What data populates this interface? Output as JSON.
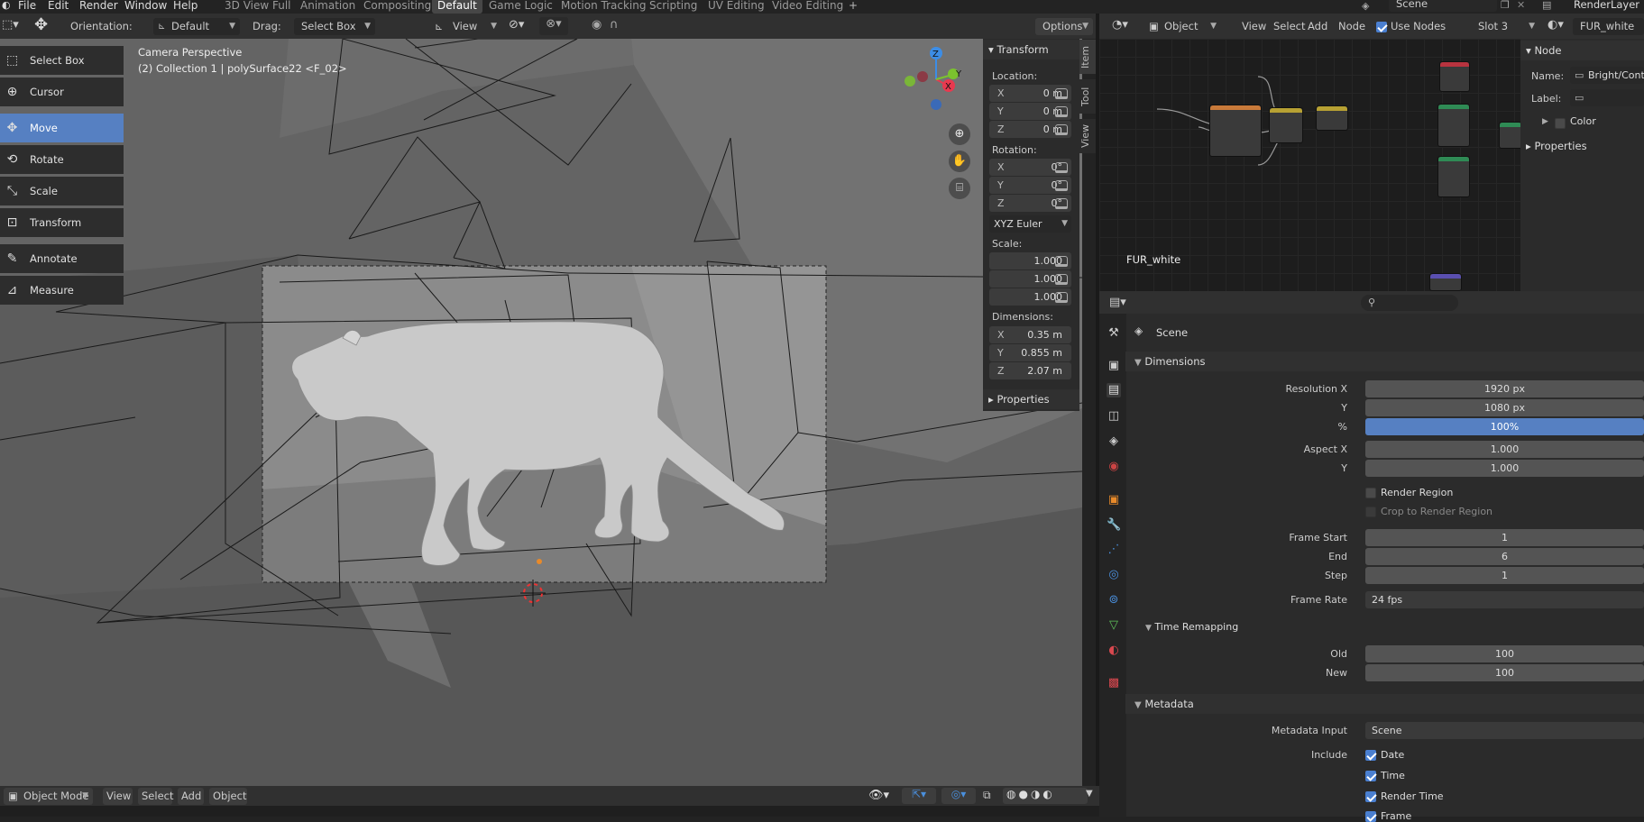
{
  "topbar": {
    "menus": [
      "File",
      "Edit",
      "Render",
      "Window",
      "Help"
    ],
    "workspaces": [
      "3D View Full",
      "Animation",
      "Compositing",
      "Default",
      "Game Logic",
      "Motion Tracking",
      "Scripting",
      "UV Editing",
      "Video Editing"
    ],
    "active_workspace": "Default",
    "add_tab": "+",
    "scene_name": "Scene",
    "view_layer": "RenderLayer"
  },
  "viewport_header": {
    "orientation_label": "Orientation:",
    "orientation_value": "Default",
    "drag_label": "Drag:",
    "drag_value": "Select Box",
    "view_menu": "View",
    "options_label": "Options"
  },
  "tools": [
    {
      "name": "Select Box",
      "icon": "select-box-icon"
    },
    {
      "name": "Cursor",
      "icon": "cursor-icon"
    },
    {
      "name": "Move",
      "icon": "move-icon",
      "active": true
    },
    {
      "name": "Rotate",
      "icon": "rotate-icon"
    },
    {
      "name": "Scale",
      "icon": "scale-icon"
    },
    {
      "name": "Transform",
      "icon": "transform-icon"
    },
    {
      "name": "Annotate",
      "icon": "annotate-icon"
    },
    {
      "name": "Measure",
      "icon": "measure-icon"
    }
  ],
  "viewport": {
    "perspective_label": "Camera Perspective",
    "collection_label": "(2) Collection 1 | polySurface22 <F_02>",
    "gizmo_axes": {
      "x": "X",
      "y": "Y",
      "z": "Z"
    },
    "colors": {
      "x": "#e8394f",
      "y": "#7bc22e",
      "z": "#3c8de6",
      "selected_outline": "#e88a2a"
    }
  },
  "npanel": {
    "transform_title": "Transform",
    "location_label": "Location:",
    "location": [
      {
        "axis": "X",
        "value": "0 m"
      },
      {
        "axis": "Y",
        "value": "0 m"
      },
      {
        "axis": "Z",
        "value": "0 m"
      }
    ],
    "rotation_label": "Rotation:",
    "rotation": [
      {
        "axis": "X",
        "value": "0°"
      },
      {
        "axis": "Y",
        "value": "0°"
      },
      {
        "axis": "Z",
        "value": "0°"
      }
    ],
    "rotation_mode": "XYZ Euler",
    "scale_label": "Scale:",
    "scale": [
      "1.000",
      "1.000",
      "1.000"
    ],
    "dimensions_label": "Dimensions:",
    "dimensions": [
      {
        "axis": "X",
        "value": "0.35 m"
      },
      {
        "axis": "Y",
        "value": "0.855 m"
      },
      {
        "axis": "Z",
        "value": "2.07 m"
      }
    ],
    "properties_title": "Properties",
    "side_tabs": [
      "Item",
      "Tool",
      "View"
    ]
  },
  "node_editor": {
    "mode": "Object",
    "menus": [
      "View",
      "Select",
      "Add",
      "Node"
    ],
    "use_nodes_label": "Use Nodes",
    "slot": "Slot 3",
    "material": "FUR_white",
    "material_label": "FUR_white"
  },
  "node_sidebar": {
    "node_title": "Node",
    "name_label": "Name:",
    "name_value": "Bright/Contr",
    "label_label": "Label:",
    "color_label": "Color",
    "properties_label": "Properties"
  },
  "properties": {
    "scene_label": "Scene",
    "dimensions_title": "Dimensions",
    "resolution_x_label": "Resolution X",
    "resolution_x": "1920 px",
    "resolution_y_label": "Y",
    "resolution_y": "1080 px",
    "percent_label": "%",
    "percent": "100%",
    "aspect_x_label": "Aspect X",
    "aspect_x": "1.000",
    "aspect_y_label": "Y",
    "aspect_y": "1.000",
    "render_region_label": "Render Region",
    "crop_label": "Crop to Render Region",
    "frame_start_label": "Frame Start",
    "frame_start": "1",
    "frame_end_label": "End",
    "frame_end": "6",
    "frame_step_label": "Step",
    "frame_step": "1",
    "frame_rate_label": "Frame Rate",
    "frame_rate": "24 fps",
    "time_remapping_title": "Time Remapping",
    "old_label": "Old",
    "old": "100",
    "new_label": "New",
    "new": "100",
    "metadata_title": "Metadata",
    "metadata_input_label": "Metadata Input",
    "metadata_input": "Scene",
    "include_label": "Include",
    "include_items": [
      "Date",
      "Time",
      "Render Time",
      "Frame"
    ]
  },
  "bottom_bar": {
    "mode": "Object Mode",
    "menus": [
      "View",
      "Select",
      "Add",
      "Object"
    ]
  }
}
